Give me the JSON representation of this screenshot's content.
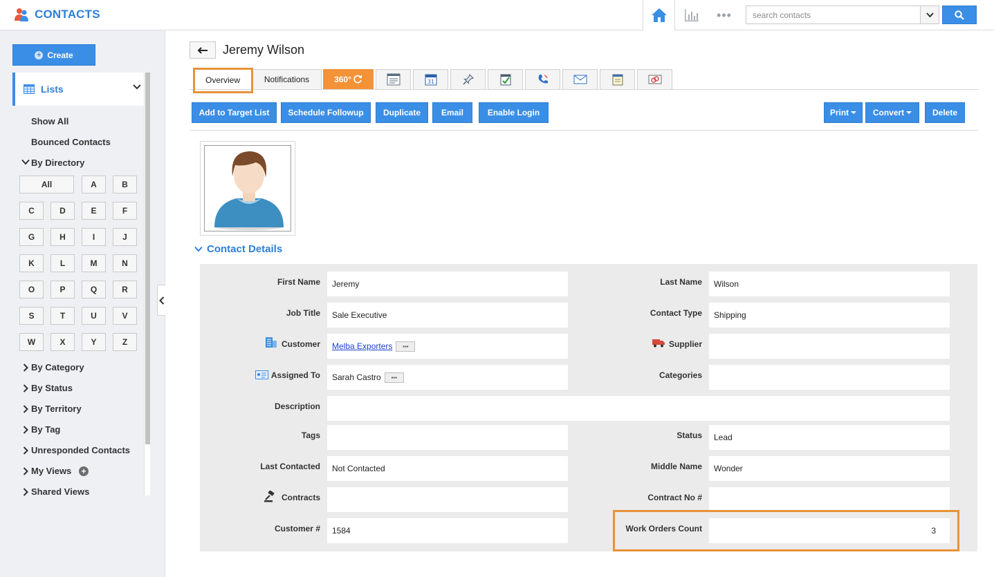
{
  "app": {
    "title": "CONTACTS",
    "accent": "#3a8ee6",
    "highlight": "#e8923a"
  },
  "search": {
    "placeholder": "search contacts"
  },
  "sidebar": {
    "create_label": "Create",
    "lists_label": "Lists",
    "items": {
      "show_all": "Show All",
      "bounced": "Bounced Contacts",
      "by_directory": "By Directory",
      "by_category": "By Category",
      "by_status": "By Status",
      "by_territory": "By Territory",
      "by_tag": "By Tag",
      "unresponded": "Unresponded Contacts",
      "my_views": "My Views",
      "shared_views": "Shared Views"
    },
    "directory": [
      "All",
      "A",
      "B",
      "C",
      "D",
      "E",
      "F",
      "G",
      "H",
      "I",
      "J",
      "K",
      "L",
      "M",
      "N",
      "O",
      "P",
      "Q",
      "R",
      "S",
      "T",
      "U",
      "V",
      "W",
      "X",
      "Y",
      "Z"
    ]
  },
  "page": {
    "title": "Jeremy Wilson"
  },
  "tabs": {
    "overview": "Overview",
    "notifications": "Notifications",
    "three_sixty": "360°"
  },
  "actions": {
    "add_to_target": "Add to Target List",
    "schedule_followup": "Schedule Followup",
    "duplicate": "Duplicate",
    "email": "Email",
    "enable_login": "Enable Login",
    "print": "Print",
    "convert": "Convert",
    "delete": "Delete"
  },
  "section": {
    "title": "Contact Details"
  },
  "fields": {
    "first_name": {
      "label": "First Name",
      "value": "Jeremy"
    },
    "last_name": {
      "label": "Last Name",
      "value": "Wilson"
    },
    "job_title": {
      "label": "Job Title",
      "value": "Sale Executive"
    },
    "contact_type": {
      "label": "Contact Type",
      "value": "Shipping"
    },
    "customer": {
      "label": "Customer",
      "value": "Melba Exporters"
    },
    "supplier": {
      "label": "Supplier",
      "value": ""
    },
    "assigned_to": {
      "label": "Assigned To",
      "value": "Sarah Castro"
    },
    "categories": {
      "label": "Categories",
      "value": ""
    },
    "description": {
      "label": "Description",
      "value": ""
    },
    "tags": {
      "label": "Tags",
      "value": ""
    },
    "status": {
      "label": "Status",
      "value": "Lead"
    },
    "last_contacted": {
      "label": "Last Contacted",
      "value": "Not Contacted"
    },
    "middle_name": {
      "label": "Middle Name",
      "value": "Wonder"
    },
    "contracts": {
      "label": "Contracts",
      "value": ""
    },
    "contract_no": {
      "label": "Contract No #",
      "value": ""
    },
    "customer_no": {
      "label": "Customer #",
      "value": "1584"
    },
    "work_orders_count": {
      "label": "Work Orders Count",
      "value": "3"
    }
  }
}
